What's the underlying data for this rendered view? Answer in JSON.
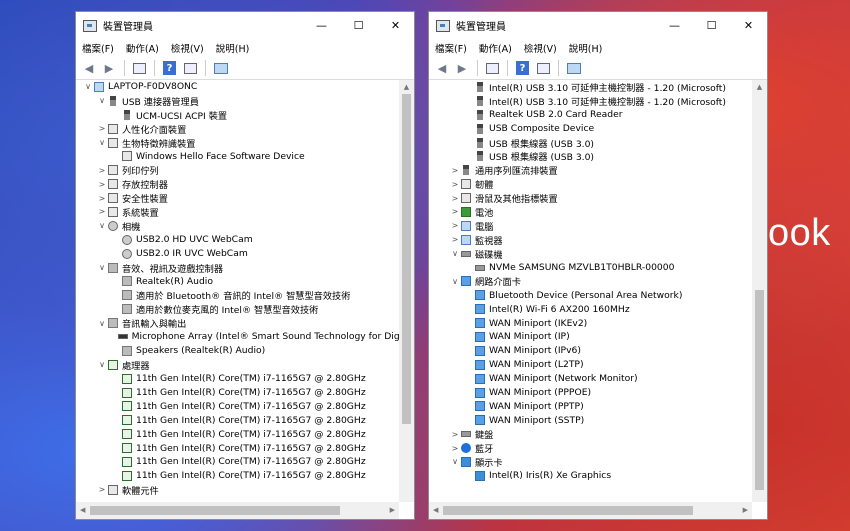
{
  "background_text": "ook",
  "window_title": "裝置管理員",
  "menus": [
    "檔案(F)",
    "動作(A)",
    "檢視(V)",
    "說明(H)"
  ],
  "controls": {
    "minimize": "—",
    "maximize": "☐",
    "close": "✕"
  },
  "left_tree": [
    {
      "level": 0,
      "exp": "∨",
      "icon": "pc",
      "label": "LAPTOP-F0DV8ONC"
    },
    {
      "level": 1,
      "exp": "∨",
      "icon": "usb",
      "label": "USB 連接器管理員"
    },
    {
      "level": 2,
      "exp": "",
      "icon": "usb",
      "label": "UCM-UCSI ACPI 裝置"
    },
    {
      "level": 1,
      "exp": ">",
      "icon": "dev",
      "label": "人性化介面裝置"
    },
    {
      "level": 1,
      "exp": "∨",
      "icon": "dev",
      "label": "生物特徵辨識裝置"
    },
    {
      "level": 2,
      "exp": "",
      "icon": "dev",
      "label": "Windows Hello Face Software Device"
    },
    {
      "level": 1,
      "exp": ">",
      "icon": "dev",
      "label": "列印佇列"
    },
    {
      "level": 1,
      "exp": ">",
      "icon": "dev",
      "label": "存放控制器"
    },
    {
      "level": 1,
      "exp": ">",
      "icon": "dev",
      "label": "安全性裝置"
    },
    {
      "level": 1,
      "exp": ">",
      "icon": "dev",
      "label": "系統裝置"
    },
    {
      "level": 1,
      "exp": "∨",
      "icon": "cam",
      "label": "相機"
    },
    {
      "level": 2,
      "exp": "",
      "icon": "cam",
      "label": "USB2.0 HD UVC WebCam"
    },
    {
      "level": 2,
      "exp": "",
      "icon": "cam",
      "label": "USB2.0 IR UVC WebCam"
    },
    {
      "level": 1,
      "exp": "∨",
      "icon": "spk",
      "label": "音效、視訊及遊戲控制器"
    },
    {
      "level": 2,
      "exp": "",
      "icon": "spk",
      "label": "Realtek(R) Audio"
    },
    {
      "level": 2,
      "exp": "",
      "icon": "spk",
      "label": "適用於 Bluetooth® 音訊的 Intel® 智慧型音效技術"
    },
    {
      "level": 2,
      "exp": "",
      "icon": "spk",
      "label": "適用於數位麥克風的 Intel® 智慧型音效技術"
    },
    {
      "level": 1,
      "exp": "∨",
      "icon": "spk",
      "label": "音訊輸入與輸出"
    },
    {
      "level": 2,
      "exp": "",
      "icon": "mic",
      "label": "Microphone Array (Intel® Smart Sound Technology for Digital"
    },
    {
      "level": 2,
      "exp": "",
      "icon": "spk",
      "label": "Speakers (Realtek(R) Audio)"
    },
    {
      "level": 1,
      "exp": "∨",
      "icon": "cpu",
      "label": "處理器"
    },
    {
      "level": 2,
      "exp": "",
      "icon": "cpu",
      "label": "11th Gen Intel(R) Core(TM) i7-1165G7 @ 2.80GHz"
    },
    {
      "level": 2,
      "exp": "",
      "icon": "cpu",
      "label": "11th Gen Intel(R) Core(TM) i7-1165G7 @ 2.80GHz"
    },
    {
      "level": 2,
      "exp": "",
      "icon": "cpu",
      "label": "11th Gen Intel(R) Core(TM) i7-1165G7 @ 2.80GHz"
    },
    {
      "level": 2,
      "exp": "",
      "icon": "cpu",
      "label": "11th Gen Intel(R) Core(TM) i7-1165G7 @ 2.80GHz"
    },
    {
      "level": 2,
      "exp": "",
      "icon": "cpu",
      "label": "11th Gen Intel(R) Core(TM) i7-1165G7 @ 2.80GHz"
    },
    {
      "level": 2,
      "exp": "",
      "icon": "cpu",
      "label": "11th Gen Intel(R) Core(TM) i7-1165G7 @ 2.80GHz"
    },
    {
      "level": 2,
      "exp": "",
      "icon": "cpu",
      "label": "11th Gen Intel(R) Core(TM) i7-1165G7 @ 2.80GHz"
    },
    {
      "level": 2,
      "exp": "",
      "icon": "cpu",
      "label": "11th Gen Intel(R) Core(TM) i7-1165G7 @ 2.80GHz"
    },
    {
      "level": 1,
      "exp": ">",
      "icon": "dev",
      "label": "軟體元件"
    }
  ],
  "right_tree": [
    {
      "level": 2,
      "exp": "",
      "icon": "usb",
      "label": "Intel(R) USB 3.10 可延伸主機控制器 - 1.20 (Microsoft)"
    },
    {
      "level": 2,
      "exp": "",
      "icon": "usb",
      "label": "Intel(R) USB 3.10 可延伸主機控制器 - 1.20 (Microsoft)"
    },
    {
      "level": 2,
      "exp": "",
      "icon": "usb",
      "label": "Realtek USB 2.0 Card Reader"
    },
    {
      "level": 2,
      "exp": "",
      "icon": "usb",
      "label": "USB Composite Device"
    },
    {
      "level": 2,
      "exp": "",
      "icon": "usb",
      "label": "USB 根集線器 (USB 3.0)"
    },
    {
      "level": 2,
      "exp": "",
      "icon": "usb",
      "label": "USB 根集線器 (USB 3.0)"
    },
    {
      "level": 1,
      "exp": ">",
      "icon": "usb",
      "label": "通用序列匯流排裝置"
    },
    {
      "level": 1,
      "exp": ">",
      "icon": "dev",
      "label": "韌體"
    },
    {
      "level": 1,
      "exp": ">",
      "icon": "dev",
      "label": "滑鼠及其他指標裝置"
    },
    {
      "level": 1,
      "exp": ">",
      "icon": "green",
      "label": "電池"
    },
    {
      "level": 1,
      "exp": ">",
      "icon": "pc",
      "label": "電腦"
    },
    {
      "level": 1,
      "exp": ">",
      "icon": "pc",
      "label": "監視器"
    },
    {
      "level": 1,
      "exp": "∨",
      "icon": "disk",
      "label": "磁碟機"
    },
    {
      "level": 2,
      "exp": "",
      "icon": "disk",
      "label": "NVMe SAMSUNG MZVLB1T0HBLR-00000"
    },
    {
      "level": 1,
      "exp": "∨",
      "icon": "net",
      "label": "網路介面卡"
    },
    {
      "level": 2,
      "exp": "",
      "icon": "net",
      "label": "Bluetooth Device (Personal Area Network)"
    },
    {
      "level": 2,
      "exp": "",
      "icon": "net",
      "label": "Intel(R) Wi-Fi 6 AX200 160MHz"
    },
    {
      "level": 2,
      "exp": "",
      "icon": "net",
      "label": "WAN Miniport (IKEv2)"
    },
    {
      "level": 2,
      "exp": "",
      "icon": "net",
      "label": "WAN Miniport (IP)"
    },
    {
      "level": 2,
      "exp": "",
      "icon": "net",
      "label": "WAN Miniport (IPv6)"
    },
    {
      "level": 2,
      "exp": "",
      "icon": "net",
      "label": "WAN Miniport (L2TP)"
    },
    {
      "level": 2,
      "exp": "",
      "icon": "net",
      "label": "WAN Miniport (Network Monitor)"
    },
    {
      "level": 2,
      "exp": "",
      "icon": "net",
      "label": "WAN Miniport (PPPOE)"
    },
    {
      "level": 2,
      "exp": "",
      "icon": "net",
      "label": "WAN Miniport (PPTP)"
    },
    {
      "level": 2,
      "exp": "",
      "icon": "net",
      "label": "WAN Miniport (SSTP)"
    },
    {
      "level": 1,
      "exp": ">",
      "icon": "disk",
      "label": "鍵盤"
    },
    {
      "level": 1,
      "exp": ">",
      "icon": "bt",
      "label": "藍牙"
    },
    {
      "level": 1,
      "exp": "∨",
      "icon": "disp",
      "label": "顯示卡"
    },
    {
      "level": 2,
      "exp": "",
      "icon": "disp",
      "label": "Intel(R) Iris(R) Xe Graphics"
    }
  ]
}
